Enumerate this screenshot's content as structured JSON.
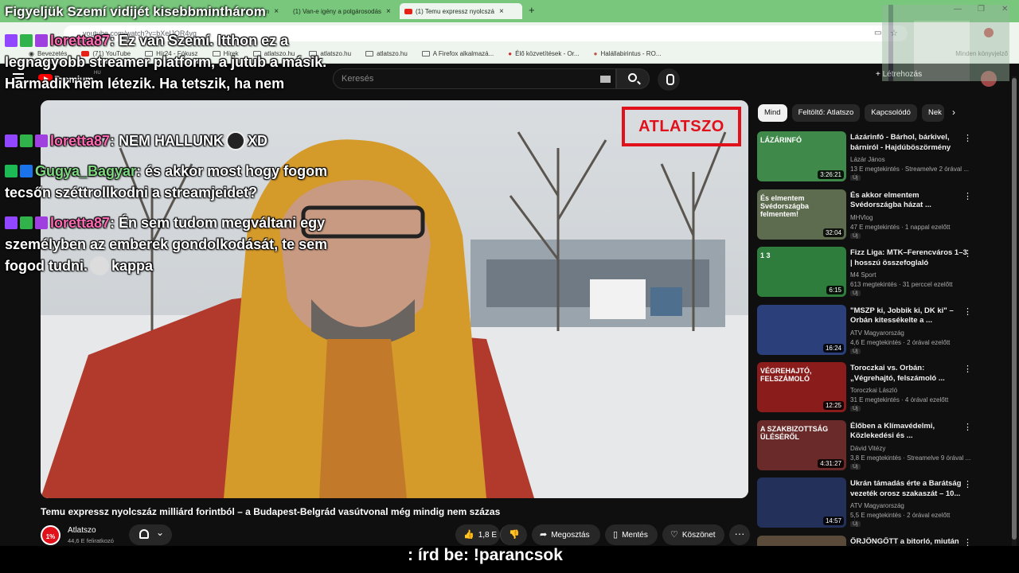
{
  "browser": {
    "tabs": [
      {
        "label": "Figyeljük Szemí vidijét kisebbminthárom",
        "active": false
      },
      {
        "label": "(1) Van-e igény a polgárosodás",
        "active": false
      },
      {
        "label": "(1) Temu expressz nyolcszá",
        "active": true
      }
    ],
    "url": "youtube.com/watch?v=bXelJOR4vg",
    "bookmarks": [
      "Bevezetés",
      "(71) YouTube",
      "Hír24 - Fókusz",
      "Hírek",
      "atlatszo.hu",
      "atlatszo.hu",
      "atlatszo.hu",
      "A Firefox alkalmazá...",
      "Élő közvetítések - Or...",
      "Halállabirintus - RO..."
    ],
    "bookmarks_right": "Minden könyvjelző"
  },
  "youtube": {
    "brand": "Premium",
    "region": "HU",
    "search_placeholder": "Keresés",
    "create_label": "Létrehozás"
  },
  "video": {
    "watermark": "ATLATSZO",
    "title": "Temu expressz nyolcszáz milliárd forintból – a Budapest-Belgrád vasútvonal még mindig nem százas",
    "channel": "Atlatszo",
    "channel_avatar_text": "1%",
    "subscribers": "44,6 E feliratkozó",
    "likes": "1,8 E",
    "share_label": "Megosztás",
    "save_label": "Mentés",
    "thanks_label": "Köszönet"
  },
  "chips": [
    "Mind",
    "Feltöltő: Atlatszo",
    "Kapcsolódó",
    "Nek"
  ],
  "recommendations": [
    {
      "title": "Lázárinfó - Bárhol, bárkivel, bárniról - Hajdúböszörmény",
      "channel": "Lázár János",
      "meta": "13 E megtekintés · Streamelve 2 órával ...",
      "duration": "3:26:21",
      "badge": "Új",
      "thumb_text": "LÁZÁRINFÓ",
      "color": "#3f8a4a"
    },
    {
      "title": "És akkor elmentem Svédországba házat ...",
      "channel": "MHVlog",
      "meta": "47 E megtekintés · 1 nappal ezelőtt",
      "duration": "32:04",
      "badge": "Új",
      "thumb_text": "És elmentem Svédországba felmentem!",
      "color": "#5d6b4e"
    },
    {
      "title": "Fizz Liga: MTK–Ferencváros 1–3 | hosszú összefoglaló",
      "channel": "M4 Sport",
      "meta": "613 megtekintés · 31 perccel ezelőtt",
      "duration": "6:15",
      "badge": "Új",
      "thumb_text": "1 3",
      "color": "#2e7d3c"
    },
    {
      "title": "\"MSZP ki, Jobbik ki, DK ki\" – Orbán kitessékelte a ...",
      "channel": "ATV Magyarország",
      "meta": "4,6 E megtekintés · 2 órával ezelőtt",
      "duration": "16:24",
      "badge": "Új",
      "thumb_text": "",
      "color": "#2b3f7a"
    },
    {
      "title": "Toroczkai vs. Orbán: „Végrehajtó, felszámoló ...",
      "channel": "Toroczkai László",
      "meta": "31 E megtekintés · 4 órával ezelőtt",
      "duration": "12:25",
      "badge": "Új",
      "thumb_text": "VÉGREHAJTÓ, FELSZÁMOLÓ",
      "color": "#8a1c1c"
    },
    {
      "title": "Élőben a Klímavédelmi, Közlekedési és ...",
      "channel": "Dávid Vitézy",
      "meta": "3,8 E megtekintés · Streamelve 9 órával ...",
      "duration": "4:31:27",
      "badge": "Új",
      "thumb_text": "A SZAKBIZOTTSÁG ÜLÉSÉRŐL",
      "color": "#6b2a2a"
    },
    {
      "title": "Ukrán támadás érte a Barátság vezeték orosz szakaszát – 10...",
      "channel": "ATV Magyarország",
      "meta": "5,5 E megtekintés · 2 órával ezelőtt",
      "duration": "14:57",
      "badge": "Új",
      "thumb_text": "",
      "color": "#23305a"
    },
    {
      "title": "ŐRJÖNGŐTT a bitorló, miután KIDERÜLT a HÁZRÓL...",
      "channel": "",
      "meta": "",
      "duration": "",
      "badge": "",
      "thumb_text": "",
      "color": "#5a4a3a"
    }
  ],
  "overlay": {
    "title": "Figyeljük Szemí vidijét kisebbminthárom",
    "chat": [
      {
        "nick": "loretta87",
        "text": ": Ez van Szemí. Itthon ez a legnagyobb streamer platform, a jutub a másik. Harmadik nem létezik. Ha tetszik, ha nem",
        "color": "pink"
      },
      {
        "nick": "loretta87",
        "text": ": NEM HALLUNK",
        "suffix": "XD",
        "color": "pink"
      },
      {
        "nick": "Gugya_Bagyar",
        "text": ": és akkor most hogy fogom tecsőn széttrollkodni a streamjeidet?",
        "color": "green"
      },
      {
        "nick": "loretta87",
        "text": ": Én sem tudom megváltani egy személyben az emberek gondolkodását, te sem fogod tudni.",
        "suffix": "kappa",
        "color": "pink"
      }
    ],
    "command": ": írd be: !parancsok"
  }
}
